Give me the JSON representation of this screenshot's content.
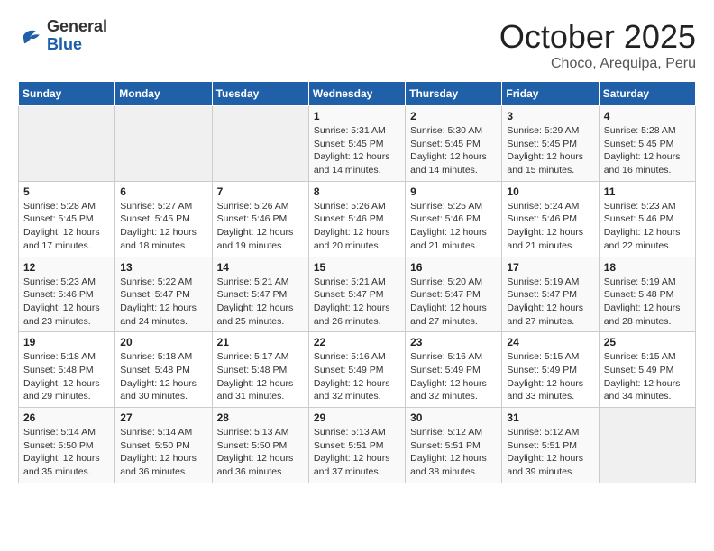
{
  "header": {
    "logo_general": "General",
    "logo_blue": "Blue",
    "title": "October 2025",
    "subtitle": "Choco, Arequipa, Peru"
  },
  "weekdays": [
    "Sunday",
    "Monday",
    "Tuesday",
    "Wednesday",
    "Thursday",
    "Friday",
    "Saturday"
  ],
  "weeks": [
    [
      {
        "day": "",
        "info": ""
      },
      {
        "day": "",
        "info": ""
      },
      {
        "day": "",
        "info": ""
      },
      {
        "day": "1",
        "info": "Sunrise: 5:31 AM\nSunset: 5:45 PM\nDaylight: 12 hours\nand 14 minutes."
      },
      {
        "day": "2",
        "info": "Sunrise: 5:30 AM\nSunset: 5:45 PM\nDaylight: 12 hours\nand 14 minutes."
      },
      {
        "day": "3",
        "info": "Sunrise: 5:29 AM\nSunset: 5:45 PM\nDaylight: 12 hours\nand 15 minutes."
      },
      {
        "day": "4",
        "info": "Sunrise: 5:28 AM\nSunset: 5:45 PM\nDaylight: 12 hours\nand 16 minutes."
      }
    ],
    [
      {
        "day": "5",
        "info": "Sunrise: 5:28 AM\nSunset: 5:45 PM\nDaylight: 12 hours\nand 17 minutes."
      },
      {
        "day": "6",
        "info": "Sunrise: 5:27 AM\nSunset: 5:45 PM\nDaylight: 12 hours\nand 18 minutes."
      },
      {
        "day": "7",
        "info": "Sunrise: 5:26 AM\nSunset: 5:46 PM\nDaylight: 12 hours\nand 19 minutes."
      },
      {
        "day": "8",
        "info": "Sunrise: 5:26 AM\nSunset: 5:46 PM\nDaylight: 12 hours\nand 20 minutes."
      },
      {
        "day": "9",
        "info": "Sunrise: 5:25 AM\nSunset: 5:46 PM\nDaylight: 12 hours\nand 21 minutes."
      },
      {
        "day": "10",
        "info": "Sunrise: 5:24 AM\nSunset: 5:46 PM\nDaylight: 12 hours\nand 21 minutes."
      },
      {
        "day": "11",
        "info": "Sunrise: 5:23 AM\nSunset: 5:46 PM\nDaylight: 12 hours\nand 22 minutes."
      }
    ],
    [
      {
        "day": "12",
        "info": "Sunrise: 5:23 AM\nSunset: 5:46 PM\nDaylight: 12 hours\nand 23 minutes."
      },
      {
        "day": "13",
        "info": "Sunrise: 5:22 AM\nSunset: 5:47 PM\nDaylight: 12 hours\nand 24 minutes."
      },
      {
        "day": "14",
        "info": "Sunrise: 5:21 AM\nSunset: 5:47 PM\nDaylight: 12 hours\nand 25 minutes."
      },
      {
        "day": "15",
        "info": "Sunrise: 5:21 AM\nSunset: 5:47 PM\nDaylight: 12 hours\nand 26 minutes."
      },
      {
        "day": "16",
        "info": "Sunrise: 5:20 AM\nSunset: 5:47 PM\nDaylight: 12 hours\nand 27 minutes."
      },
      {
        "day": "17",
        "info": "Sunrise: 5:19 AM\nSunset: 5:47 PM\nDaylight: 12 hours\nand 27 minutes."
      },
      {
        "day": "18",
        "info": "Sunrise: 5:19 AM\nSunset: 5:48 PM\nDaylight: 12 hours\nand 28 minutes."
      }
    ],
    [
      {
        "day": "19",
        "info": "Sunrise: 5:18 AM\nSunset: 5:48 PM\nDaylight: 12 hours\nand 29 minutes."
      },
      {
        "day": "20",
        "info": "Sunrise: 5:18 AM\nSunset: 5:48 PM\nDaylight: 12 hours\nand 30 minutes."
      },
      {
        "day": "21",
        "info": "Sunrise: 5:17 AM\nSunset: 5:48 PM\nDaylight: 12 hours\nand 31 minutes."
      },
      {
        "day": "22",
        "info": "Sunrise: 5:16 AM\nSunset: 5:49 PM\nDaylight: 12 hours\nand 32 minutes."
      },
      {
        "day": "23",
        "info": "Sunrise: 5:16 AM\nSunset: 5:49 PM\nDaylight: 12 hours\nand 32 minutes."
      },
      {
        "day": "24",
        "info": "Sunrise: 5:15 AM\nSunset: 5:49 PM\nDaylight: 12 hours\nand 33 minutes."
      },
      {
        "day": "25",
        "info": "Sunrise: 5:15 AM\nSunset: 5:49 PM\nDaylight: 12 hours\nand 34 minutes."
      }
    ],
    [
      {
        "day": "26",
        "info": "Sunrise: 5:14 AM\nSunset: 5:50 PM\nDaylight: 12 hours\nand 35 minutes."
      },
      {
        "day": "27",
        "info": "Sunrise: 5:14 AM\nSunset: 5:50 PM\nDaylight: 12 hours\nand 36 minutes."
      },
      {
        "day": "28",
        "info": "Sunrise: 5:13 AM\nSunset: 5:50 PM\nDaylight: 12 hours\nand 36 minutes."
      },
      {
        "day": "29",
        "info": "Sunrise: 5:13 AM\nSunset: 5:51 PM\nDaylight: 12 hours\nand 37 minutes."
      },
      {
        "day": "30",
        "info": "Sunrise: 5:12 AM\nSunset: 5:51 PM\nDaylight: 12 hours\nand 38 minutes."
      },
      {
        "day": "31",
        "info": "Sunrise: 5:12 AM\nSunset: 5:51 PM\nDaylight: 12 hours\nand 39 minutes."
      },
      {
        "day": "",
        "info": ""
      }
    ]
  ]
}
